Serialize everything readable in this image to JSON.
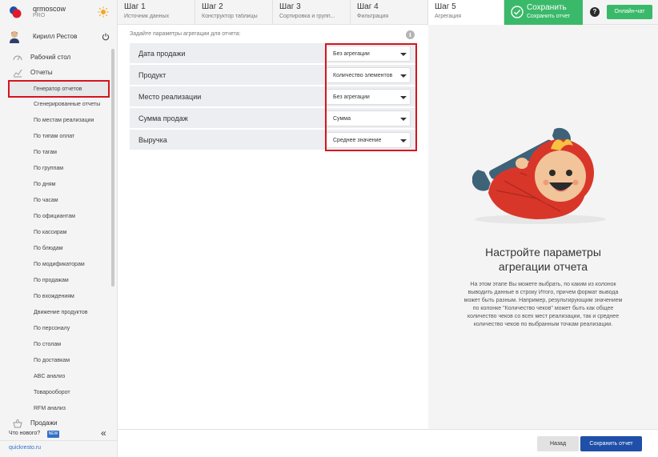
{
  "brand": {
    "name": "qrmoscow",
    "plan": "PRO"
  },
  "user": {
    "name": "Кирилл Рестов"
  },
  "sidebar": {
    "desktop": "Рабочий стол",
    "reports": "Отчеты",
    "items": [
      "Генератор отчетов",
      "Сгенерированные отчеты",
      "По местам реализации",
      "По типам оплат",
      "По тагам",
      "По группам",
      "По дням",
      "По часам",
      "По официантам",
      "По кассирам",
      "По блюдам",
      "По модификаторам",
      "По продажам",
      "По вхождениям",
      "Движение продуктов",
      "По персоналу",
      "По столам",
      "По доставкам",
      "ABC анализ",
      "Товарооборот",
      "RFM анализ"
    ],
    "sales": "Продажи",
    "whats_new": "Что нового?",
    "new_badge": "NEW",
    "collapse": "«",
    "site": "quickresto.ru"
  },
  "steps": [
    {
      "title": "Шаг 1",
      "subtitle": "Источник данных"
    },
    {
      "title": "Шаг 2",
      "subtitle": "Конструктор таблицы"
    },
    {
      "title": "Шаг 3",
      "subtitle": "Сортировка и групп..."
    },
    {
      "title": "Шаг 4",
      "subtitle": "Фильтрация"
    },
    {
      "title": "Шаг 5",
      "subtitle": "Агрегация"
    }
  ],
  "save_top": {
    "title": "Сохранить",
    "subtitle": "Сохранить отчет"
  },
  "help": "?",
  "chat": "Онлайн-чат",
  "main": {
    "hint": "Задайте параметры агрегации для отчета:",
    "info": "i",
    "rows": [
      {
        "label": "Дата продажи",
        "value": "Без агрегации"
      },
      {
        "label": "Продукт",
        "value": "Количество элементов"
      },
      {
        "label": "Место реализации",
        "value": "Без агрегации"
      },
      {
        "label": "Сумма продаж",
        "value": "Сумма"
      },
      {
        "label": "Выручка",
        "value": "Среднее значение"
      }
    ]
  },
  "right": {
    "title_line1": "Настройте параметры",
    "title_line2": "агрегации отчета",
    "description": "На этом этапе Вы можете выбрать, по каким из колонок выводить данные в строку Итого, причем формат вывода может быть разным. Например, результирующим значением по колонке \"Количество чеков\" может быть как общее количество чеков со всех мест реализации, так и среднее количество чеков по выбранным точкам реализации."
  },
  "footer": {
    "back": "Назад",
    "save": "Сохранить отчет"
  },
  "colors": {
    "accent_green": "#3ab96a",
    "primary_blue": "#1f4fa8",
    "highlight_red": "#d6141f"
  }
}
